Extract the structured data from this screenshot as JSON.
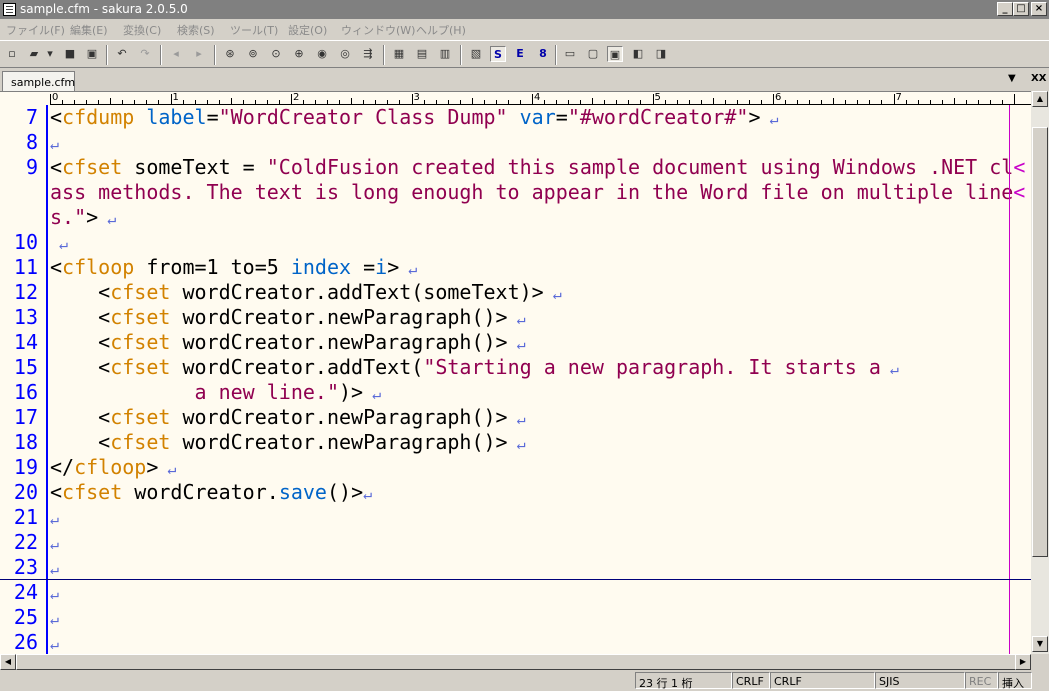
{
  "window": {
    "title": "sample.cfm - sakura 2.0.5.0",
    "controls": [
      "_",
      "□",
      "×"
    ]
  },
  "menu": [
    "ファイル(F)",
    "編集(E)",
    "変換(C)",
    "検索(S)",
    "ツール(T)",
    "設定(O)",
    "ウィンドウ(W)",
    "ヘルプ(H)"
  ],
  "toolbar": {
    "search_s": "S",
    "search_e": "E",
    "search_8": "8"
  },
  "tabs": {
    "active": "sample.cfm",
    "menu_arrow": "▼",
    "close_all": "XX"
  },
  "ruler": {
    "labels": [
      "0",
      "1",
      "2",
      "3",
      "4",
      "5",
      "6",
      "7"
    ]
  },
  "editor": {
    "line_numbers": [
      "7",
      "8",
      "9",
      "",
      "",
      "10",
      "11",
      "12",
      "13",
      "14",
      "15",
      "16",
      "17",
      "18",
      "19",
      "20",
      "21",
      "22",
      "23",
      "24",
      "25",
      "26"
    ],
    "lines": [
      [
        {
          "t": "<",
          "c": "pn"
        },
        {
          "t": "cfdump",
          "c": "tg"
        },
        {
          "t": " ",
          "c": "pn"
        },
        {
          "t": "label",
          "c": "kw"
        },
        {
          "t": "=",
          "c": "pn"
        },
        {
          "t": "\"WordCreator Class Dump\"",
          "c": "st"
        },
        {
          "t": " ",
          "c": "pn"
        },
        {
          "t": "var",
          "c": "kw"
        },
        {
          "t": "=",
          "c": "pn"
        },
        {
          "t": "\"#wordCreator#\"",
          "c": "st"
        },
        {
          "t": ">",
          "c": "pn"
        },
        {
          "t": " ↵",
          "c": "ret"
        }
      ],
      [
        {
          "t": "↵",
          "c": "ret"
        }
      ],
      [
        {
          "t": "<",
          "c": "pn"
        },
        {
          "t": "cfset",
          "c": "tg"
        },
        {
          "t": " someText = ",
          "c": "pn"
        },
        {
          "t": "\"ColdFusion created this sample document using Windows .NET cl",
          "c": "st"
        },
        {
          "t": "<",
          "c": "wrapm"
        }
      ],
      [
        {
          "t": "ass methods. The text is long enough to appear in the Word file on multiple line",
          "c": "st"
        },
        {
          "t": "<",
          "c": "wrapm"
        }
      ],
      [
        {
          "t": "s.\"",
          "c": "st"
        },
        {
          "t": ">",
          "c": "pn"
        },
        {
          "t": " ↵",
          "c": "ret"
        }
      ],
      [
        {
          "t": " ↵",
          "c": "ret"
        }
      ],
      [
        {
          "t": "<",
          "c": "pn"
        },
        {
          "t": "cfloop",
          "c": "tg"
        },
        {
          "t": " from=1 to=5 ",
          "c": "pn"
        },
        {
          "t": "index",
          "c": "kw"
        },
        {
          "t": " =",
          "c": "pn"
        },
        {
          "t": "i",
          "c": "kw"
        },
        {
          "t": ">",
          "c": "pn"
        },
        {
          "t": " ↵",
          "c": "ret"
        }
      ],
      [
        {
          "t": "    <",
          "c": "pn"
        },
        {
          "t": "cfset",
          "c": "tg"
        },
        {
          "t": " wordCreator.addText(someText)>",
          "c": "pn"
        },
        {
          "t": " ↵",
          "c": "ret"
        }
      ],
      [
        {
          "t": "    <",
          "c": "pn"
        },
        {
          "t": "cfset",
          "c": "tg"
        },
        {
          "t": " wordCreator.newParagraph()>",
          "c": "pn"
        },
        {
          "t": " ↵",
          "c": "ret"
        }
      ],
      [
        {
          "t": "    <",
          "c": "pn"
        },
        {
          "t": "cfset",
          "c": "tg"
        },
        {
          "t": " wordCreator.newParagraph()>",
          "c": "pn"
        },
        {
          "t": " ↵",
          "c": "ret"
        }
      ],
      [
        {
          "t": "    <",
          "c": "pn"
        },
        {
          "t": "cfset",
          "c": "tg"
        },
        {
          "t": " wordCreator.addText(",
          "c": "pn"
        },
        {
          "t": "\"Starting a new paragraph. It starts a",
          "c": "st"
        },
        {
          "t": " ↵",
          "c": "ret"
        }
      ],
      [
        {
          "t": "            ",
          "c": "pn"
        },
        {
          "t": "a new line.\"",
          "c": "st"
        },
        {
          "t": ")>",
          "c": "pn"
        },
        {
          "t": " ↵",
          "c": "ret"
        }
      ],
      [
        {
          "t": "    <",
          "c": "pn"
        },
        {
          "t": "cfset",
          "c": "tg"
        },
        {
          "t": " wordCreator.newParagraph()>",
          "c": "pn"
        },
        {
          "t": " ↵",
          "c": "ret"
        }
      ],
      [
        {
          "t": "    <",
          "c": "pn"
        },
        {
          "t": "cfset",
          "c": "tg"
        },
        {
          "t": " wordCreator.newParagraph()>",
          "c": "pn"
        },
        {
          "t": " ↵",
          "c": "ret"
        }
      ],
      [
        {
          "t": "</",
          "c": "pn"
        },
        {
          "t": "cfloop",
          "c": "tg"
        },
        {
          "t": ">",
          "c": "pn"
        },
        {
          "t": " ↵",
          "c": "ret"
        }
      ],
      [
        {
          "t": "<",
          "c": "pn"
        },
        {
          "t": "cfset",
          "c": "tg"
        },
        {
          "t": " wordCreator.",
          "c": "pn"
        },
        {
          "t": "save",
          "c": "kw"
        },
        {
          "t": "()>",
          "c": "pn"
        },
        {
          "t": "↵",
          "c": "ret"
        }
      ],
      [
        {
          "t": "↵",
          "c": "ret"
        }
      ],
      [
        {
          "t": "↵",
          "c": "ret"
        }
      ],
      [
        {
          "t": "↵",
          "c": "ret"
        }
      ],
      [
        {
          "t": "↵",
          "c": "ret"
        }
      ],
      [
        {
          "t": "↵",
          "c": "ret"
        }
      ],
      [
        {
          "t": "↵",
          "c": "ret"
        }
      ]
    ]
  },
  "status": {
    "position": "23 行    1 桁",
    "line_end_1": "CRLF",
    "line_end_2": "CRLF",
    "encoding": "SJIS",
    "rec": "REC",
    "mode": "挿入"
  }
}
